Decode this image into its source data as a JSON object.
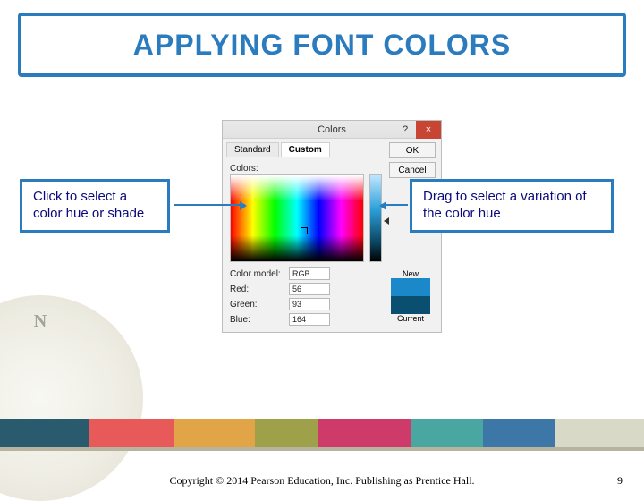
{
  "title": "APPLYING FONT COLORS",
  "dialog": {
    "title": "Colors",
    "tabs": {
      "standard": "Standard",
      "custom": "Custom"
    },
    "buttons": {
      "ok": "OK",
      "cancel": "Cancel"
    },
    "colors_label": "Colors:",
    "fields": {
      "model_label": "Color model:",
      "model_value": "RGB",
      "red_label": "Red:",
      "red_value": "56",
      "green_label": "Green:",
      "green_value": "93",
      "blue_label": "Blue:",
      "blue_value": "164"
    },
    "preview": {
      "new_label": "New",
      "current_label": "Current"
    },
    "close": "×",
    "help": "?"
  },
  "callouts": {
    "left": "Click to select a color hue or shade",
    "right": "Drag to select a variation of the color hue"
  },
  "footer": {
    "copyright": "Copyright © 2014 Pearson Education, Inc. Publishing as Prentice Hall.",
    "page": "9"
  }
}
